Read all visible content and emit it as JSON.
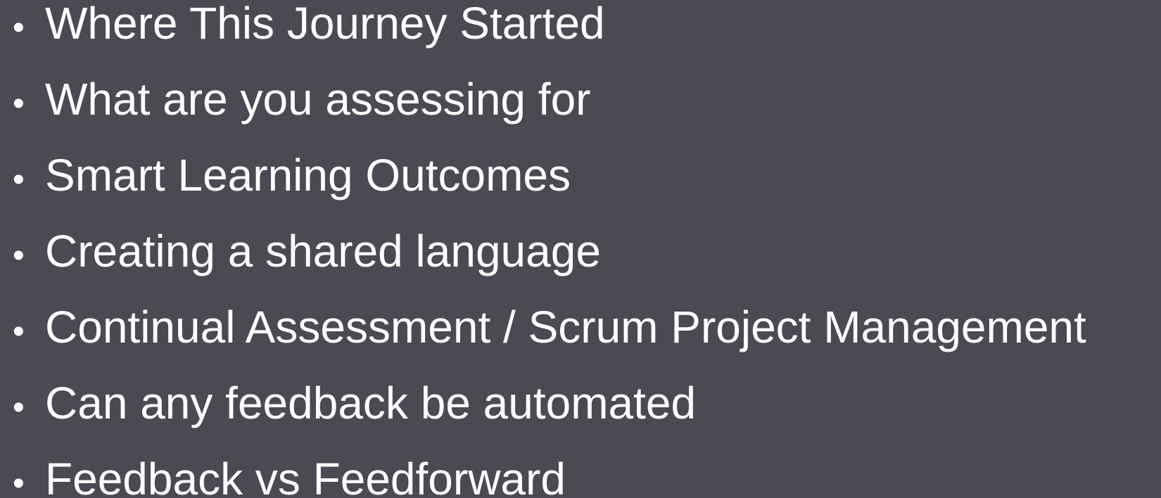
{
  "slide": {
    "background_color": "#4a4a52",
    "text_color": "#ffffff",
    "bullet_glyph": "•",
    "items": [
      {
        "label": "Where This Journey Started"
      },
      {
        "label": "What are you assessing for"
      },
      {
        "label": "Smart Learning Outcomes"
      },
      {
        "label": "Creating a shared language"
      },
      {
        "label": "Continual Assessment / Scrum Project Management"
      },
      {
        "label": "Can any feedback be automated"
      },
      {
        "label": "Feedback vs Feedforward"
      }
    ]
  }
}
